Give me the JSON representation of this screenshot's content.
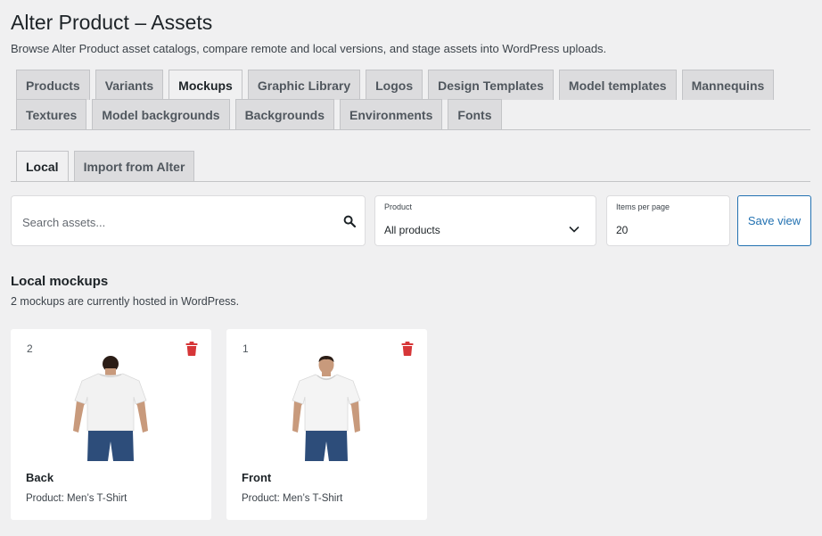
{
  "page": {
    "title": "Alter Product – Assets",
    "description": "Browse Alter Product asset catalogs, compare remote and local versions, and stage assets into WordPress uploads."
  },
  "tabs_row1": [
    {
      "label": "Products",
      "active": false
    },
    {
      "label": "Variants",
      "active": false
    },
    {
      "label": "Mockups",
      "active": true
    },
    {
      "label": "Graphic Library",
      "active": false
    },
    {
      "label": "Logos",
      "active": false
    },
    {
      "label": "Design Templates",
      "active": false
    },
    {
      "label": "Model templates",
      "active": false
    },
    {
      "label": "Mannequins",
      "active": false
    }
  ],
  "tabs_row2": [
    {
      "label": "Textures",
      "active": false
    },
    {
      "label": "Model backgrounds",
      "active": false
    },
    {
      "label": "Backgrounds",
      "active": false
    },
    {
      "label": "Environments",
      "active": false
    },
    {
      "label": "Fonts",
      "active": false
    }
  ],
  "subtabs": [
    {
      "label": "Local",
      "active": true
    },
    {
      "label": "Import from Alter",
      "active": false
    }
  ],
  "filters": {
    "search_placeholder": "Search assets...",
    "search_icon": "search-icon",
    "product_label": "Product",
    "product_value": "All products",
    "per_page_label": "Items per page",
    "per_page_value": "20",
    "save_label": "Save view"
  },
  "section": {
    "title": "Local mockups",
    "subtitle": "2 mockups are currently hosted in WordPress."
  },
  "cards": [
    {
      "number": "2",
      "name": "Back",
      "product": "Product: Men’s T-Shirt",
      "view": "back"
    },
    {
      "number": "1",
      "name": "Front",
      "product": "Product: Men’s T-Shirt",
      "view": "front"
    }
  ],
  "colors": {
    "accent": "#2271b1",
    "danger": "#d63638",
    "background": "#f0f0f1"
  }
}
